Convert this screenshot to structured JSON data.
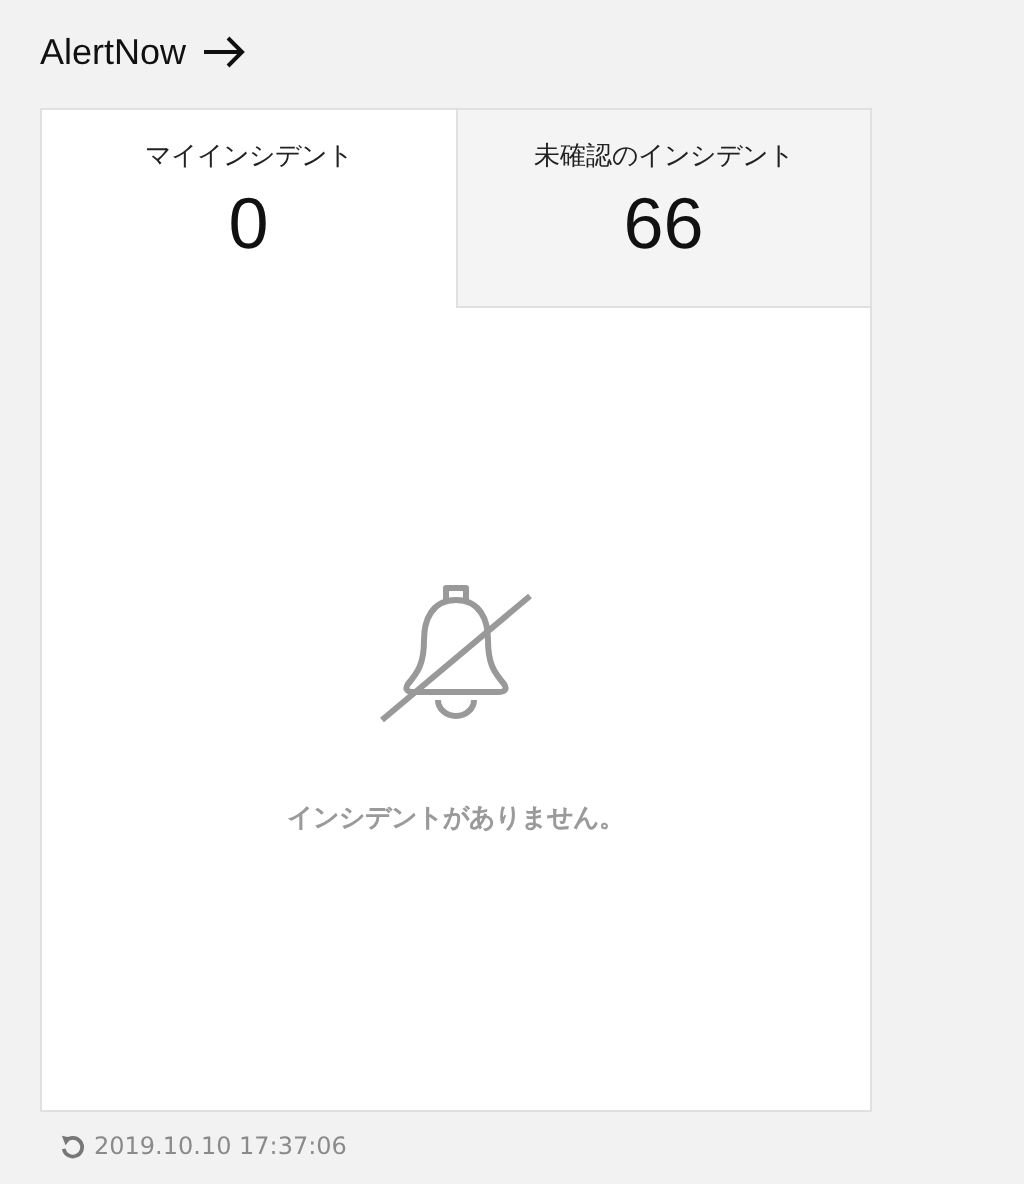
{
  "header": {
    "title": "AlertNow"
  },
  "tabs": [
    {
      "label": "マイインシデント",
      "count": "0",
      "selected": true
    },
    {
      "label": "未確認のインシデント",
      "count": "66",
      "selected": false
    }
  ],
  "empty_state": {
    "message": "インシデントがありません。"
  },
  "footer": {
    "updated": "2019.10.10 17:37:06"
  }
}
